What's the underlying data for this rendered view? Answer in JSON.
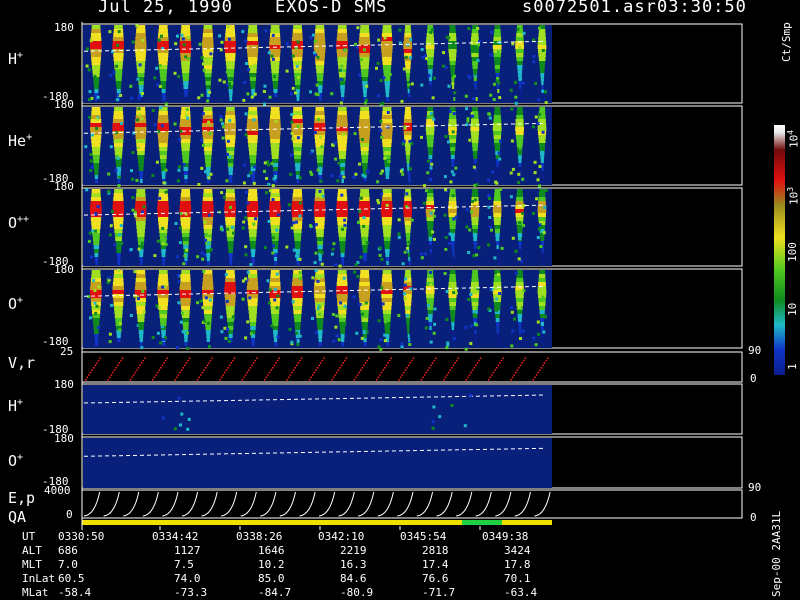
{
  "header": {
    "date": "Jul 25, 1990",
    "instrument": "EXOS-D SMS",
    "file": "s0072501.asr",
    "time": "03:30:50"
  },
  "panels": [
    {
      "label": "H",
      "sup": "+",
      "ymax": "180",
      "ymin": "-180"
    },
    {
      "label": "He",
      "sup": "+",
      "ymax": "180",
      "ymin": "-180"
    },
    {
      "label": "O",
      "sup": "++",
      "ymax": "180",
      "ymin": "-180"
    },
    {
      "label": "O",
      "sup": "+",
      "ymax": "180",
      "ymin": "-180"
    },
    {
      "label": "V,r",
      "ymax": "25",
      "right_top": "90",
      "right_bottom": "0"
    },
    {
      "label": "H",
      "sup": "+",
      "ymax": "180",
      "ymin": "-180"
    },
    {
      "label": "O",
      "sup": "+",
      "ymax": "180",
      "ymin": "-180"
    },
    {
      "label": "E,p",
      "label2": "QA",
      "ymax": "4000",
      "ymid": "0",
      "right_top": "90",
      "right_bottom": "0"
    }
  ],
  "colorbar": {
    "unit": "Ct/Smp",
    "ticks": [
      "10",
      "4",
      "10",
      "3",
      "100",
      "10",
      "1"
    ]
  },
  "footer_label": "Sep-00 2AA31L",
  "table": {
    "rows": [
      {
        "name": "UT",
        "values": [
          "0330:50",
          "0334:42",
          "0338:26",
          "0342:10",
          "0345:54",
          "0349:38"
        ]
      },
      {
        "name": "ALT",
        "values": [
          "686",
          "1127",
          "1646",
          "2219",
          "2818",
          "3424"
        ]
      },
      {
        "name": "MLT",
        "values": [
          "7.0",
          "7.5",
          "10.2",
          "16.3",
          "17.4",
          "17.8"
        ]
      },
      {
        "name": "InLat",
        "values": [
          "60.5",
          "74.0",
          "85.0",
          "84.6",
          "76.6",
          "70.1"
        ]
      },
      {
        "name": "MLat",
        "values": [
          "-58.4",
          "-73.3",
          "-84.7",
          "-80.9",
          "-71.7",
          "-63.4"
        ]
      }
    ]
  },
  "chart_data": {
    "type": "heatmap",
    "colors": {
      "background": "#000000",
      "data_background": "#08207a",
      "spin_dots": "#ff2020",
      "qa_bar_main": "#f0e000",
      "qa_bar_flag": "#20d040"
    }
  }
}
